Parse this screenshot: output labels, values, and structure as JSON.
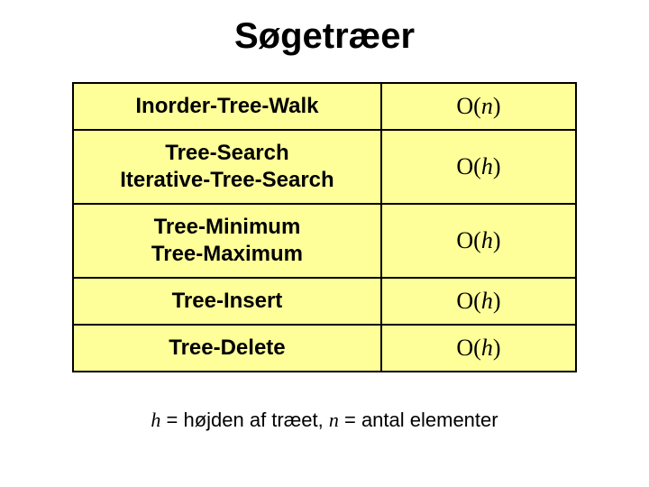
{
  "title": "Søgetræer",
  "rows": [
    {
      "op": "Inorder-Tree-Walk",
      "cx_prefix": "O(",
      "cx_var": "n",
      "cx_suffix": ")"
    },
    {
      "op": "Tree-Search\nIterative-Tree-Search",
      "cx_prefix": "O(",
      "cx_var": "h",
      "cx_suffix": ")"
    },
    {
      "op": "Tree-Minimum\nTree-Maximum",
      "cx_prefix": "O(",
      "cx_var": "h",
      "cx_suffix": ")"
    },
    {
      "op": "Tree-Insert",
      "cx_prefix": "O(",
      "cx_var": "h",
      "cx_suffix": ")"
    },
    {
      "op": "Tree-Delete",
      "cx_prefix": "O(",
      "cx_var": "h",
      "cx_suffix": ")"
    }
  ],
  "footnote": {
    "h_var": "h",
    "h_text": "  = højden af træet,   ",
    "n_var": "n",
    "n_text": " = antal elementer"
  }
}
